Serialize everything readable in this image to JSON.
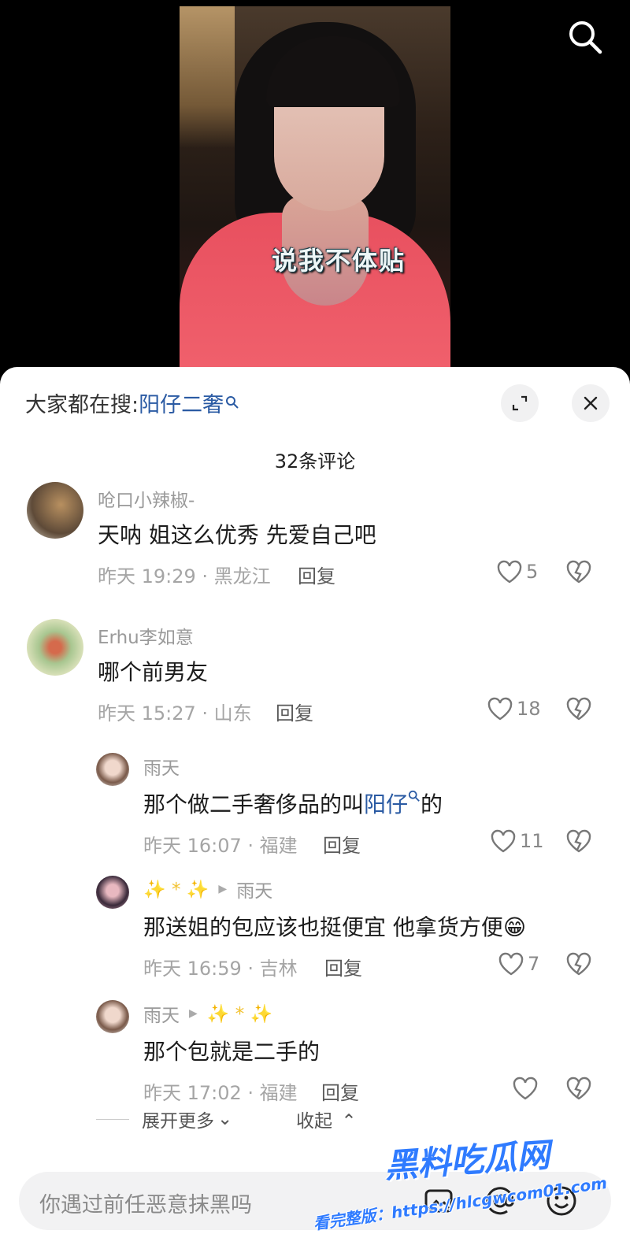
{
  "video": {
    "caption": "说我不体贴"
  },
  "panel": {
    "hot_search_label": "大家都在搜:",
    "hot_search_term": "阳仔二奢",
    "comment_count": "32条评论"
  },
  "comments": [
    {
      "user": "呛口小辣椒-",
      "text": "天呐 姐这么优秀 先爱自己吧",
      "meta": "昨天 19:29 · 黑龙江",
      "reply": "回复",
      "likes": "5"
    },
    {
      "user": "Erhu李如意",
      "text": "哪个前男友",
      "meta": "昨天 15:27 · 山东",
      "reply": "回复",
      "likes": "18"
    }
  ],
  "replies": [
    {
      "user": "雨天",
      "text_pre": "那个做二手奢侈品的叫",
      "text_link": "阳仔",
      "text_post": "的",
      "meta": "昨天 16:07 · 福建",
      "reply": "回复",
      "likes": "11"
    },
    {
      "user": "✨ * ✨",
      "to": "雨天",
      "text": "那送姐的包应该也挺便宜 他拿货方便😁",
      "meta": "昨天 16:59 · 吉林",
      "reply": "回复",
      "likes": "7"
    },
    {
      "user": "雨天",
      "to": "✨ * ✨",
      "text": "那个包就是二手的",
      "meta": "昨天 17:02 · 福建",
      "reply": "回复",
      "likes": ""
    }
  ],
  "thread_controls": {
    "expand": "展开更多",
    "collapse": "收起"
  },
  "input": {
    "placeholder": "你遇过前任恶意抹黑吗"
  },
  "watermark": {
    "title": "黑料吃瓜网",
    "url": "看完整版：https://hlcgwcom01.com"
  }
}
